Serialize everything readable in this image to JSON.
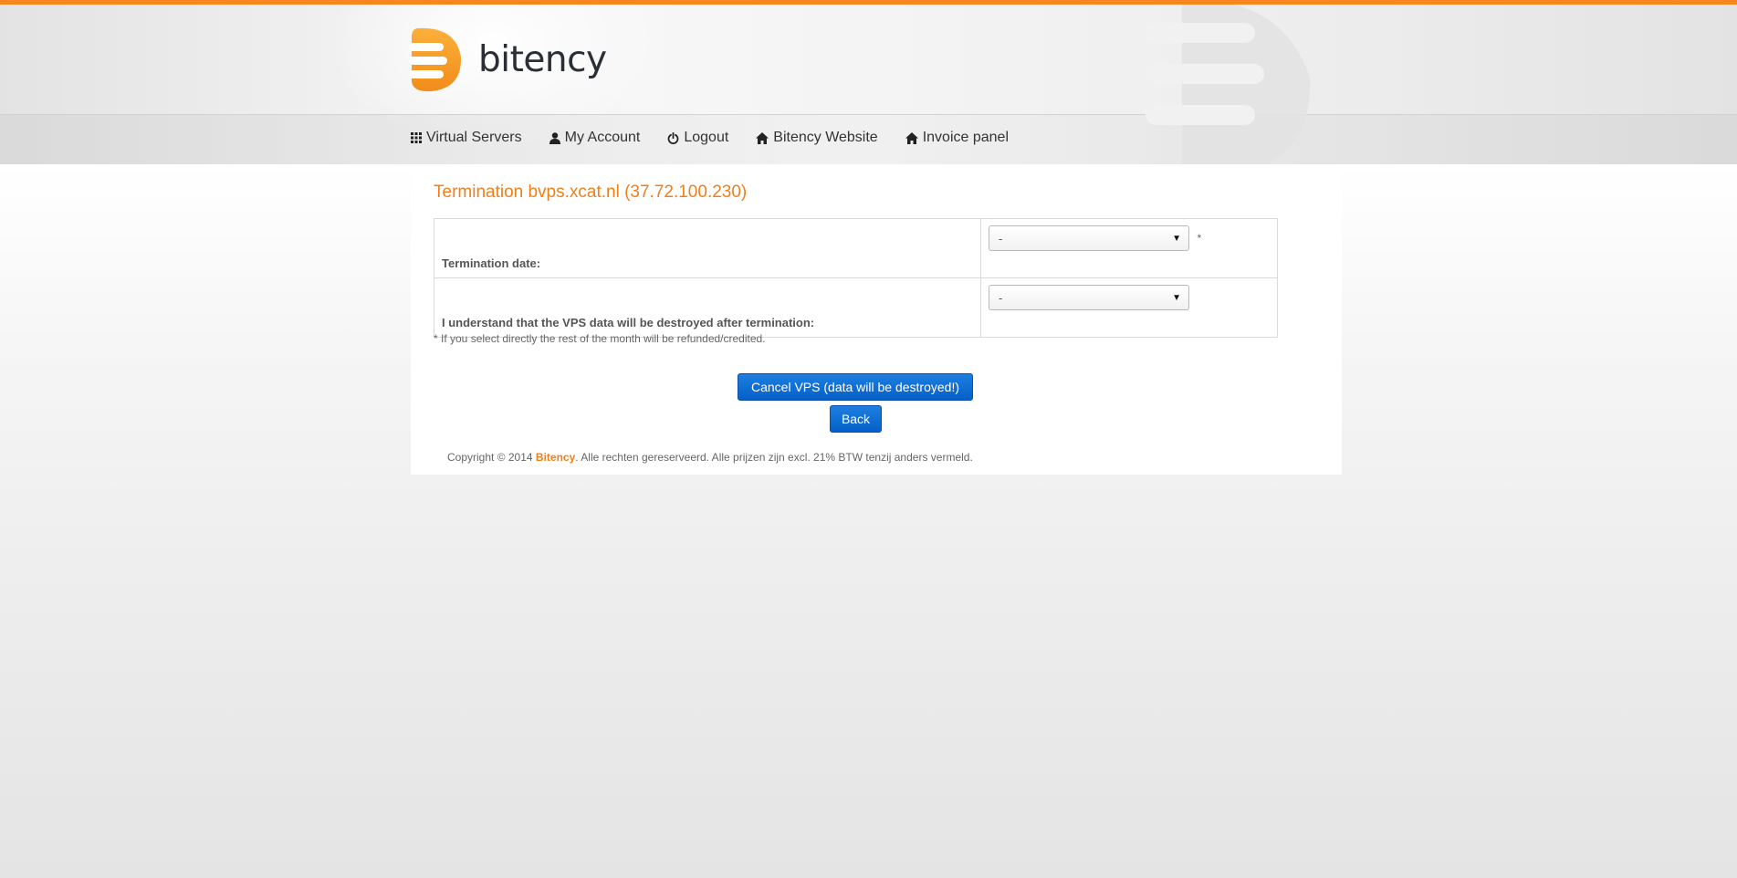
{
  "brand": {
    "name": "bitency",
    "accent_color": "#f7861e",
    "text_color": "#2a2f36"
  },
  "nav": {
    "items": [
      {
        "label": "Virtual Servers",
        "icon": "grid-icon"
      },
      {
        "label": "My Account",
        "icon": "user-icon"
      },
      {
        "label": "Logout",
        "icon": "power-icon"
      },
      {
        "label": "Bitency Website",
        "icon": "home-icon"
      },
      {
        "label": "Invoice panel",
        "icon": "home-icon"
      }
    ]
  },
  "page": {
    "title": "Termination bvps.xcat.nl (37.72.100.230)",
    "title_color": "#f07f1a"
  },
  "form": {
    "rows": [
      {
        "label": "Termination date:",
        "value": "-",
        "required_mark": "*"
      },
      {
        "label": "I understand that the VPS data will be destroyed after termination:",
        "value": "-",
        "required_mark": ""
      }
    ],
    "note": "* If you select directly the rest of the month will be refunded/credited."
  },
  "actions": {
    "cancel_label": "Cancel VPS (data will be destroyed!)",
    "back_label": "Back",
    "button_color": "#0560c8"
  },
  "footer": {
    "prefix": "Copyright © 2014 ",
    "brand": "Bitency",
    "suffix": ". Alle rechten gereserveerd. Alle prijzen zijn excl. 21% BTW tenzij anders vermeld."
  }
}
